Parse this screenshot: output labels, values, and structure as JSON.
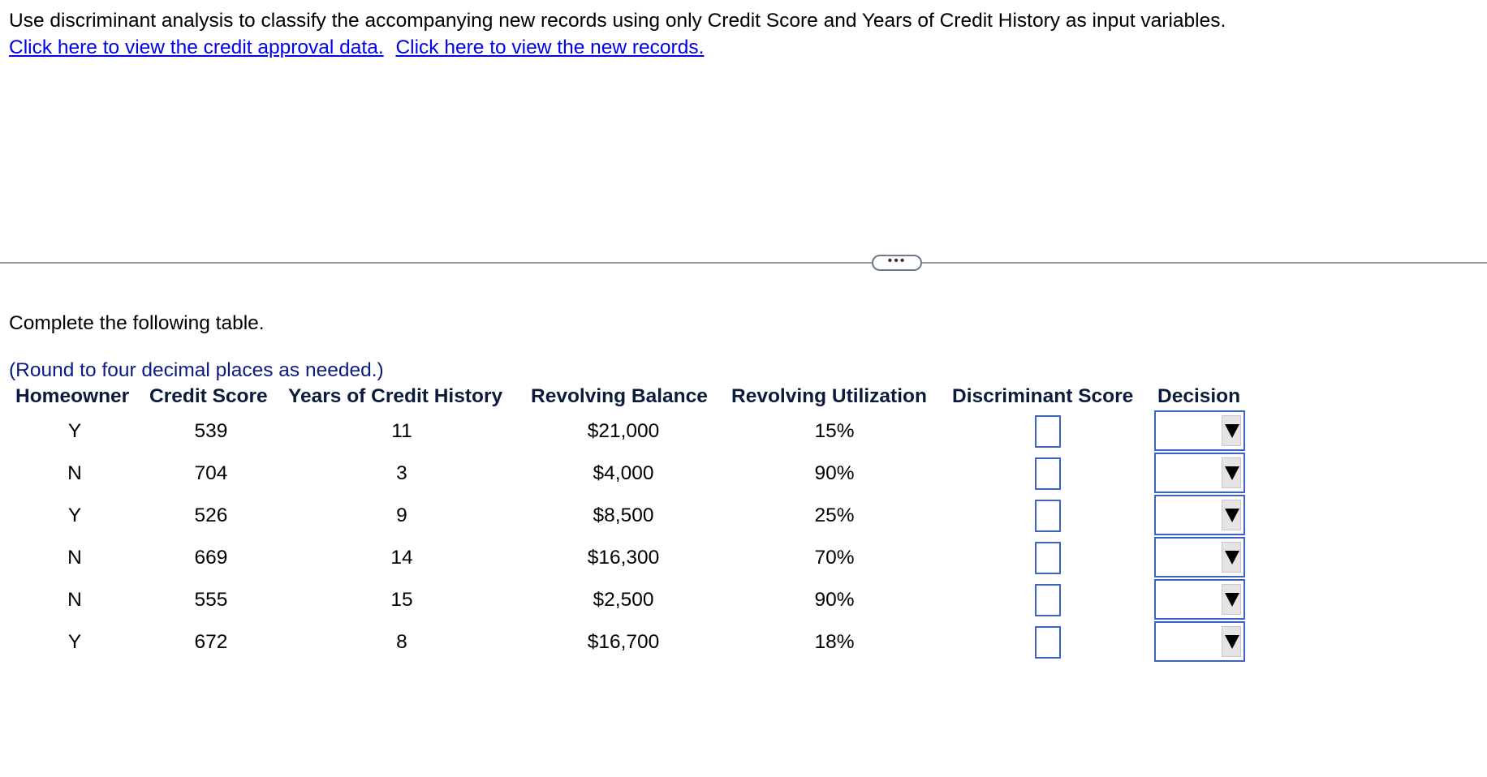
{
  "question": {
    "text": "Use discriminant analysis to classify the accompanying new records using only Credit Score and Years of Credit History as input variables.",
    "link_data": "Click here to view the credit approval data.",
    "link_records": "Click here to view the new records."
  },
  "divider": {
    "more_label": "•••"
  },
  "task": {
    "instruction": "Complete the following table.",
    "round_note": "(Round to four decimal places as needed.)"
  },
  "table": {
    "headers": [
      "Homeowner",
      "Credit Score",
      "Years of Credit History",
      "Revolving Balance",
      "Revolving Utilization",
      "Discriminant Score",
      "Decision"
    ],
    "rows": [
      {
        "homeowner": "Y",
        "credit_score": "539",
        "years": "11",
        "balance": "$21,000",
        "utilization": "15%",
        "discriminant_score": "",
        "decision": ""
      },
      {
        "homeowner": "N",
        "credit_score": "704",
        "years": "3",
        "balance": "$4,000",
        "utilization": "90%",
        "discriminant_score": "",
        "decision": ""
      },
      {
        "homeowner": "Y",
        "credit_score": "526",
        "years": "9",
        "balance": "$8,500",
        "utilization": "25%",
        "discriminant_score": "",
        "decision": ""
      },
      {
        "homeowner": "N",
        "credit_score": "669",
        "years": "14",
        "balance": "$16,300",
        "utilization": "70%",
        "discriminant_score": "",
        "decision": ""
      },
      {
        "homeowner": "N",
        "credit_score": "555",
        "years": "15",
        "balance": "$2,500",
        "utilization": "90%",
        "discriminant_score": "",
        "decision": ""
      },
      {
        "homeowner": "Y",
        "credit_score": "672",
        "years": "8",
        "balance": "$16,700",
        "utilization": "18%",
        "discriminant_score": "",
        "decision": ""
      }
    ]
  }
}
